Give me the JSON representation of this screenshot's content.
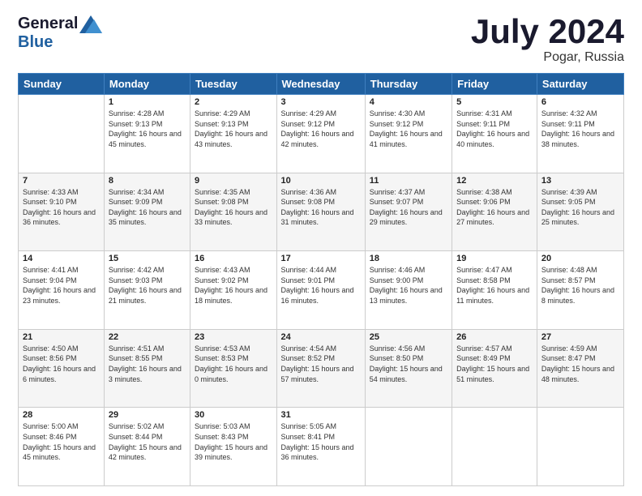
{
  "header": {
    "logo_general": "General",
    "logo_blue": "Blue",
    "month_title": "July 2024",
    "location": "Pogar, Russia"
  },
  "days_of_week": [
    "Sunday",
    "Monday",
    "Tuesday",
    "Wednesday",
    "Thursday",
    "Friday",
    "Saturday"
  ],
  "weeks": [
    [
      {
        "day": "",
        "sunrise": "",
        "sunset": "",
        "daylight": ""
      },
      {
        "day": "1",
        "sunrise": "Sunrise: 4:28 AM",
        "sunset": "Sunset: 9:13 PM",
        "daylight": "Daylight: 16 hours and 45 minutes."
      },
      {
        "day": "2",
        "sunrise": "Sunrise: 4:29 AM",
        "sunset": "Sunset: 9:13 PM",
        "daylight": "Daylight: 16 hours and 43 minutes."
      },
      {
        "day": "3",
        "sunrise": "Sunrise: 4:29 AM",
        "sunset": "Sunset: 9:12 PM",
        "daylight": "Daylight: 16 hours and 42 minutes."
      },
      {
        "day": "4",
        "sunrise": "Sunrise: 4:30 AM",
        "sunset": "Sunset: 9:12 PM",
        "daylight": "Daylight: 16 hours and 41 minutes."
      },
      {
        "day": "5",
        "sunrise": "Sunrise: 4:31 AM",
        "sunset": "Sunset: 9:11 PM",
        "daylight": "Daylight: 16 hours and 40 minutes."
      },
      {
        "day": "6",
        "sunrise": "Sunrise: 4:32 AM",
        "sunset": "Sunset: 9:11 PM",
        "daylight": "Daylight: 16 hours and 38 minutes."
      }
    ],
    [
      {
        "day": "7",
        "sunrise": "Sunrise: 4:33 AM",
        "sunset": "Sunset: 9:10 PM",
        "daylight": "Daylight: 16 hours and 36 minutes."
      },
      {
        "day": "8",
        "sunrise": "Sunrise: 4:34 AM",
        "sunset": "Sunset: 9:09 PM",
        "daylight": "Daylight: 16 hours and 35 minutes."
      },
      {
        "day": "9",
        "sunrise": "Sunrise: 4:35 AM",
        "sunset": "Sunset: 9:08 PM",
        "daylight": "Daylight: 16 hours and 33 minutes."
      },
      {
        "day": "10",
        "sunrise": "Sunrise: 4:36 AM",
        "sunset": "Sunset: 9:08 PM",
        "daylight": "Daylight: 16 hours and 31 minutes."
      },
      {
        "day": "11",
        "sunrise": "Sunrise: 4:37 AM",
        "sunset": "Sunset: 9:07 PM",
        "daylight": "Daylight: 16 hours and 29 minutes."
      },
      {
        "day": "12",
        "sunrise": "Sunrise: 4:38 AM",
        "sunset": "Sunset: 9:06 PM",
        "daylight": "Daylight: 16 hours and 27 minutes."
      },
      {
        "day": "13",
        "sunrise": "Sunrise: 4:39 AM",
        "sunset": "Sunset: 9:05 PM",
        "daylight": "Daylight: 16 hours and 25 minutes."
      }
    ],
    [
      {
        "day": "14",
        "sunrise": "Sunrise: 4:41 AM",
        "sunset": "Sunset: 9:04 PM",
        "daylight": "Daylight: 16 hours and 23 minutes."
      },
      {
        "day": "15",
        "sunrise": "Sunrise: 4:42 AM",
        "sunset": "Sunset: 9:03 PM",
        "daylight": "Daylight: 16 hours and 21 minutes."
      },
      {
        "day": "16",
        "sunrise": "Sunrise: 4:43 AM",
        "sunset": "Sunset: 9:02 PM",
        "daylight": "Daylight: 16 hours and 18 minutes."
      },
      {
        "day": "17",
        "sunrise": "Sunrise: 4:44 AM",
        "sunset": "Sunset: 9:01 PM",
        "daylight": "Daylight: 16 hours and 16 minutes."
      },
      {
        "day": "18",
        "sunrise": "Sunrise: 4:46 AM",
        "sunset": "Sunset: 9:00 PM",
        "daylight": "Daylight: 16 hours and 13 minutes."
      },
      {
        "day": "19",
        "sunrise": "Sunrise: 4:47 AM",
        "sunset": "Sunset: 8:58 PM",
        "daylight": "Daylight: 16 hours and 11 minutes."
      },
      {
        "day": "20",
        "sunrise": "Sunrise: 4:48 AM",
        "sunset": "Sunset: 8:57 PM",
        "daylight": "Daylight: 16 hours and 8 minutes."
      }
    ],
    [
      {
        "day": "21",
        "sunrise": "Sunrise: 4:50 AM",
        "sunset": "Sunset: 8:56 PM",
        "daylight": "Daylight: 16 hours and 6 minutes."
      },
      {
        "day": "22",
        "sunrise": "Sunrise: 4:51 AM",
        "sunset": "Sunset: 8:55 PM",
        "daylight": "Daylight: 16 hours and 3 minutes."
      },
      {
        "day": "23",
        "sunrise": "Sunrise: 4:53 AM",
        "sunset": "Sunset: 8:53 PM",
        "daylight": "Daylight: 16 hours and 0 minutes."
      },
      {
        "day": "24",
        "sunrise": "Sunrise: 4:54 AM",
        "sunset": "Sunset: 8:52 PM",
        "daylight": "Daylight: 15 hours and 57 minutes."
      },
      {
        "day": "25",
        "sunrise": "Sunrise: 4:56 AM",
        "sunset": "Sunset: 8:50 PM",
        "daylight": "Daylight: 15 hours and 54 minutes."
      },
      {
        "day": "26",
        "sunrise": "Sunrise: 4:57 AM",
        "sunset": "Sunset: 8:49 PM",
        "daylight": "Daylight: 15 hours and 51 minutes."
      },
      {
        "day": "27",
        "sunrise": "Sunrise: 4:59 AM",
        "sunset": "Sunset: 8:47 PM",
        "daylight": "Daylight: 15 hours and 48 minutes."
      }
    ],
    [
      {
        "day": "28",
        "sunrise": "Sunrise: 5:00 AM",
        "sunset": "Sunset: 8:46 PM",
        "daylight": "Daylight: 15 hours and 45 minutes."
      },
      {
        "day": "29",
        "sunrise": "Sunrise: 5:02 AM",
        "sunset": "Sunset: 8:44 PM",
        "daylight": "Daylight: 15 hours and 42 minutes."
      },
      {
        "day": "30",
        "sunrise": "Sunrise: 5:03 AM",
        "sunset": "Sunset: 8:43 PM",
        "daylight": "Daylight: 15 hours and 39 minutes."
      },
      {
        "day": "31",
        "sunrise": "Sunrise: 5:05 AM",
        "sunset": "Sunset: 8:41 PM",
        "daylight": "Daylight: 15 hours and 36 minutes."
      },
      {
        "day": "",
        "sunrise": "",
        "sunset": "",
        "daylight": ""
      },
      {
        "day": "",
        "sunrise": "",
        "sunset": "",
        "daylight": ""
      },
      {
        "day": "",
        "sunrise": "",
        "sunset": "",
        "daylight": ""
      }
    ]
  ]
}
